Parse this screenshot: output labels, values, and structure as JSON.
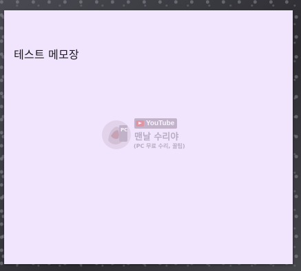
{
  "note": {
    "content": "테스트 메모장",
    "background_color": "#f1e5fd"
  },
  "watermark": {
    "logo_text": "PC",
    "youtube_label": "YouTube",
    "title": "맨날 수리야",
    "subtitle": "(PC 무료 수리, 꿀팁)"
  }
}
